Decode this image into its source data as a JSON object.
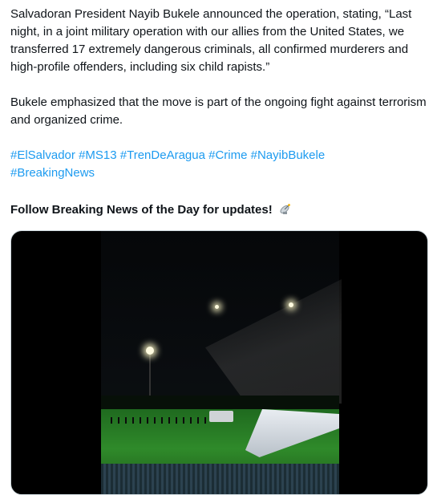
{
  "post": {
    "paragraph1": "Salvadoran President Nayib Bukele announced the operation, stating, “Last night, in a joint military operation with our allies from the United States, we transferred 17 extremely dangerous criminals, all confirmed murderers and high-profile offenders, including six child rapists.”",
    "paragraph2": "Bukele emphasized that the move is part of the ongoing fight against terrorism and organized crime.",
    "hashtags": [
      "#ElSalvador",
      "#MS13",
      "#TrenDeAragua",
      "#Crime",
      "#NayibBukele",
      "#BreakingNews"
    ],
    "cta": "Follow Breaking News of the Day for updates!",
    "cta_icon": "satellite-antenna-icon"
  },
  "media": {
    "type": "video",
    "description_icon": "video-thumbnail"
  }
}
